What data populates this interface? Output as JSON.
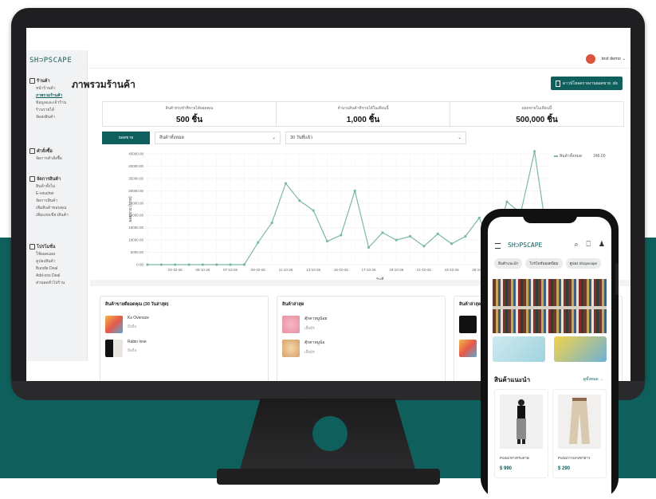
{
  "colors": {
    "brand": "#0f5f5c",
    "line": "#7bb9a4"
  },
  "brand": {
    "logo": "SH⊃PSCAPE"
  },
  "header": {
    "user": "test demo ⌄"
  },
  "page": {
    "title": "ภาพรวมร้านค้า",
    "export_label": "ดาวน์โหลดรายงานยอดขาย .xls"
  },
  "stats": [
    {
      "label": "สินค้าทรงจำที่ขายได้ยอดคุณ",
      "value": "500 ชิ้น"
    },
    {
      "label": "จำนวนสินค้าที่ขายได้ในเดือนนี้",
      "value": "1,000 ชิ้น"
    },
    {
      "label": "ยอดขายในเดือนนี้",
      "value": "500,000 ชิ้น"
    }
  ],
  "filters": {
    "button": "ยอดขาย",
    "product": "สินค้าทั้งหมด",
    "period": "30 วันที่แล้ว"
  },
  "sidebar": {
    "groups": [
      {
        "head": "ร้านค้า",
        "items": [
          "หน้าร้านค้า",
          "ภาพรวมร้านค้า",
          "ข้อมูลและเจ้าร้าน",
          "ร้านรายได้",
          "จัดส่งสินค้า"
        ]
      },
      {
        "head": "คำสั่งซื้อ",
        "items": [
          "จัดการคำสั่งซื้อ"
        ]
      },
      {
        "head": "จัดการสินค้า",
        "items": [
          "สินค้าทั้งไม่",
          "E-voucher",
          "จัดการสินค้า",
          "เพิ่มสินค้าขอบคุณ",
          "เพิ่มแท่งเขียวสินค้า"
        ]
      },
      {
        "head": "โปรโมชั่น",
        "items": [
          "ใช้ยอดแผล",
          "คูปองสินค้า",
          "Bundle Deal",
          "Add-ons Deal",
          "ส่วนลดทั่วไปร้าน"
        ]
      }
    ]
  },
  "chart_data": {
    "type": "line",
    "xlabel": "วันที่",
    "ylabel": "ยอดขาย (บาท)",
    "ylim": [
      0,
      45000
    ],
    "yticks": [
      0,
      5000,
      10000,
      15000,
      20000,
      25000,
      30000,
      35000,
      40000,
      45000
    ],
    "x": [
      "01-10-26",
      "02-10-26",
      "03-10-26",
      "04-10-26",
      "05-10-26",
      "06-10-26",
      "07-10-26",
      "08-10-26",
      "09-10-26",
      "10-10-26",
      "11-10-26",
      "12-10-26",
      "13-10-26",
      "14-10-26",
      "15-10-26",
      "16-10-26",
      "17-10-26",
      "18-10-26",
      "19-10-26",
      "20-10-26",
      "21-10-26",
      "22-10-26",
      "23-10-26",
      "24-10-26",
      "25-10-26",
      "26-10-26",
      "27-10-26",
      "28-10-26",
      "29-10-26",
      "30-10-26"
    ],
    "xticks_shown": [
      "03-10-26",
      "05-10-26",
      "07-10-26",
      "09-10-26",
      "11-10-26",
      "13-10-26",
      "15-10-26",
      "17-10-26",
      "19-10-26",
      "21-10-26",
      "23-10-26",
      "25-10-26",
      "27-10-26"
    ],
    "series": [
      {
        "name": "สินค้าทั้งหมด",
        "values": [
          0,
          0,
          0,
          0,
          0,
          0,
          0,
          0,
          9000,
          17000,
          33000,
          26000,
          22000,
          9500,
          12000,
          30000,
          7000,
          13000,
          10000,
          11500,
          7500,
          12500,
          8500,
          11500,
          19000,
          6000,
          25500,
          21000,
          46000,
          8000
        ]
      }
    ],
    "legend_value": "246.00",
    "grid": true,
    "legend": "top-right"
  },
  "cards": [
    {
      "title": "สินค้าขายดียอดคุณ (30 วันล่าสุด)",
      "items": [
        {
          "name": "Ks Oversize",
          "sub": "มือถือ"
        },
        {
          "name": "Rabin love",
          "sub": "มือถือ"
        }
      ]
    },
    {
      "title": "สินค้าล่าสุด",
      "items": [
        {
          "name": "ตุ๊กตาหมูน้อย",
          "sub": "เสื้อผุ้ช"
        },
        {
          "name": "ตุ๊กตาหมูน้อ",
          "sub": "เสื้อผุ้ช"
        }
      ]
    },
    {
      "title": "สินค้าล่าสุด"
    }
  ],
  "phone": {
    "logo": "SH⊃PSCAPE",
    "chips": [
      "สินค้าแนะนำ",
      "โปรโมชั่นยอดนิยม",
      "คูปอง Shopscape"
    ],
    "section": "สินค้าแนะนำ",
    "more": "ดูทั้งหมด →",
    "products": [
      {
        "name": "Portal ทางกระดาษ",
        "price": "$ 990"
      },
      {
        "name": "Portal กางเกงขายาว",
        "price": "$ 290"
      }
    ]
  }
}
